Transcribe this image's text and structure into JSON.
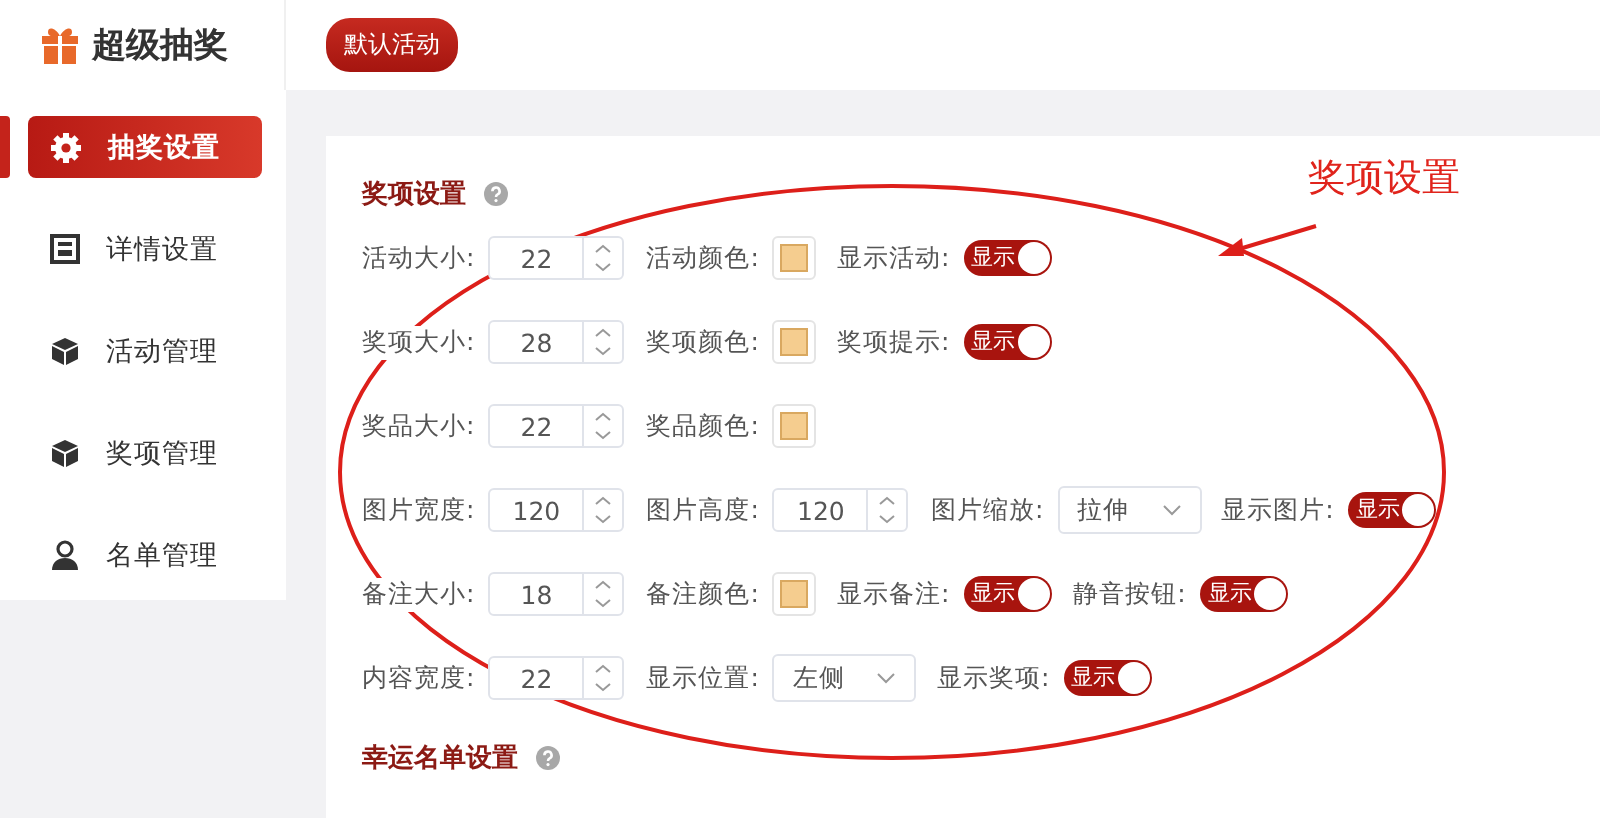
{
  "header": {
    "logo": "超级抽奖",
    "activity_button": "默认活动"
  },
  "sidebar": {
    "items": [
      {
        "label": "抽奖设置",
        "kind": "gear",
        "selected": true
      },
      {
        "label": "详情设置",
        "kind": "doc",
        "selected": false
      },
      {
        "label": "活动管理",
        "kind": "box",
        "selected": false
      },
      {
        "label": "奖项管理",
        "kind": "box",
        "selected": false
      },
      {
        "label": "名单管理",
        "kind": "person",
        "selected": false
      }
    ]
  },
  "sections": [
    {
      "title": "奖项设置",
      "rows": [
        [
          {
            "kind": "number",
            "label": "活动大小:",
            "value": "22"
          },
          {
            "kind": "color",
            "label": "活动颜色:",
            "color": "#f5cd8f"
          },
          {
            "kind": "switch",
            "label": "显示活动:",
            "text": "显示",
            "on": true
          }
        ],
        [
          {
            "kind": "number",
            "label": "奖项大小:",
            "value": "28"
          },
          {
            "kind": "color",
            "label": "奖项颜色:",
            "color": "#f5cd8f"
          },
          {
            "kind": "switch",
            "label": "奖项提示:",
            "text": "显示",
            "on": true
          }
        ],
        [
          {
            "kind": "number",
            "label": "奖品大小:",
            "value": "22"
          },
          {
            "kind": "color",
            "label": "奖品颜色:",
            "color": "#f5cd8f"
          }
        ],
        [
          {
            "kind": "number",
            "label": "图片宽度:",
            "value": "120"
          },
          {
            "kind": "number",
            "label": "图片高度:",
            "value": "120"
          },
          {
            "kind": "select",
            "label": "图片缩放:",
            "value": "拉伸"
          },
          {
            "kind": "switch",
            "label": "显示图片:",
            "text": "显示",
            "on": true
          }
        ],
        [
          {
            "kind": "number",
            "label": "备注大小:",
            "value": "18"
          },
          {
            "kind": "color",
            "label": "备注颜色:",
            "color": "#f5cd8f"
          },
          {
            "kind": "switch",
            "label": "显示备注:",
            "text": "显示",
            "on": true
          },
          {
            "kind": "switch",
            "label": "静音按钮:",
            "text": "显示",
            "on": true
          }
        ],
        [
          {
            "kind": "number",
            "label": "内容宽度:",
            "value": "22"
          },
          {
            "kind": "select",
            "label": "显示位置:",
            "value": "左侧"
          },
          {
            "kind": "switch",
            "label": "显示奖项:",
            "text": "显示",
            "on": true
          }
        ]
      ]
    },
    {
      "title": "幸运名单设置"
    }
  ],
  "annotation": {
    "text": "奖项设置"
  }
}
